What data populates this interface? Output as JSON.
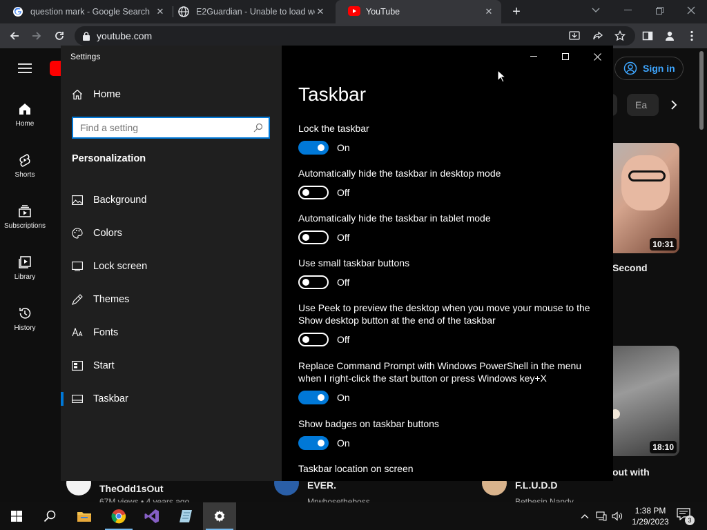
{
  "browser": {
    "tabs": [
      {
        "title": "question mark - Google Search",
        "icon": "google-g-icon"
      },
      {
        "title": "E2Guardian - Unable to load web",
        "icon": "globe-icon"
      },
      {
        "title": "YouTube",
        "icon": "youtube-icon"
      }
    ],
    "url": "youtube.com"
  },
  "youtube": {
    "nav": [
      {
        "label": "Home",
        "icon": "home-icon"
      },
      {
        "label": "Shorts",
        "icon": "shorts-icon"
      },
      {
        "label": "Subscriptions",
        "icon": "subscriptions-icon"
      },
      {
        "label": "Library",
        "icon": "library-icon"
      },
      {
        "label": "History",
        "icon": "history-icon"
      }
    ],
    "signin_label": "Sign in",
    "chip_partial": "Ea",
    "videos": [
      {
        "duration": "10:31",
        "title_partial": "Second"
      },
      {
        "duration": "18:10",
        "title_partial": "out with"
      }
    ],
    "bottom_row": [
      {
        "channel": "TheOdd1sOut",
        "meta": "67M views • 4 years ago"
      },
      {
        "title": "EVER.",
        "channel": "Mrwhosetheboss"
      },
      {
        "title": "F.L.U.D.D",
        "channel": "Bethesin Nandy"
      }
    ]
  },
  "settings": {
    "app_title": "Settings",
    "home_label": "Home",
    "search_placeholder": "Find a setting",
    "section": "Personalization",
    "nav": [
      {
        "label": "Background",
        "icon": "background-image-icon"
      },
      {
        "label": "Colors",
        "icon": "palette-icon"
      },
      {
        "label": "Lock screen",
        "icon": "lock-screen-icon"
      },
      {
        "label": "Themes",
        "icon": "themes-brush-icon"
      },
      {
        "label": "Fonts",
        "icon": "fonts-icon"
      },
      {
        "label": "Start",
        "icon": "start-icon"
      },
      {
        "label": "Taskbar",
        "icon": "taskbar-icon",
        "selected": true
      }
    ],
    "page_title": "Taskbar",
    "options": [
      {
        "label": "Lock the taskbar",
        "state": "On",
        "on": true
      },
      {
        "label": "Automatically hide the taskbar in desktop mode",
        "state": "Off",
        "on": false
      },
      {
        "label": "Automatically hide the taskbar in tablet mode",
        "state": "Off",
        "on": false
      },
      {
        "label": "Use small taskbar buttons",
        "state": "Off",
        "on": false
      },
      {
        "label": "Use Peek to preview the desktop when you move your mouse to the Show desktop button at the end of the taskbar",
        "state": "Off",
        "on": false
      },
      {
        "label": "Replace Command Prompt with Windows PowerShell in the menu when I right-click the start button or press Windows key+X",
        "state": "On",
        "on": true
      },
      {
        "label": "Show badges on taskbar buttons",
        "state": "On",
        "on": true
      }
    ],
    "next_heading": "Taskbar location on screen"
  },
  "taskbar": {
    "time": "1:38 PM",
    "date": "1/29/2023",
    "notification_count": "3"
  },
  "colors": {
    "accent": "#0078d7",
    "yt_red": "#ff0000",
    "yt_blue": "#3ea6ff"
  }
}
